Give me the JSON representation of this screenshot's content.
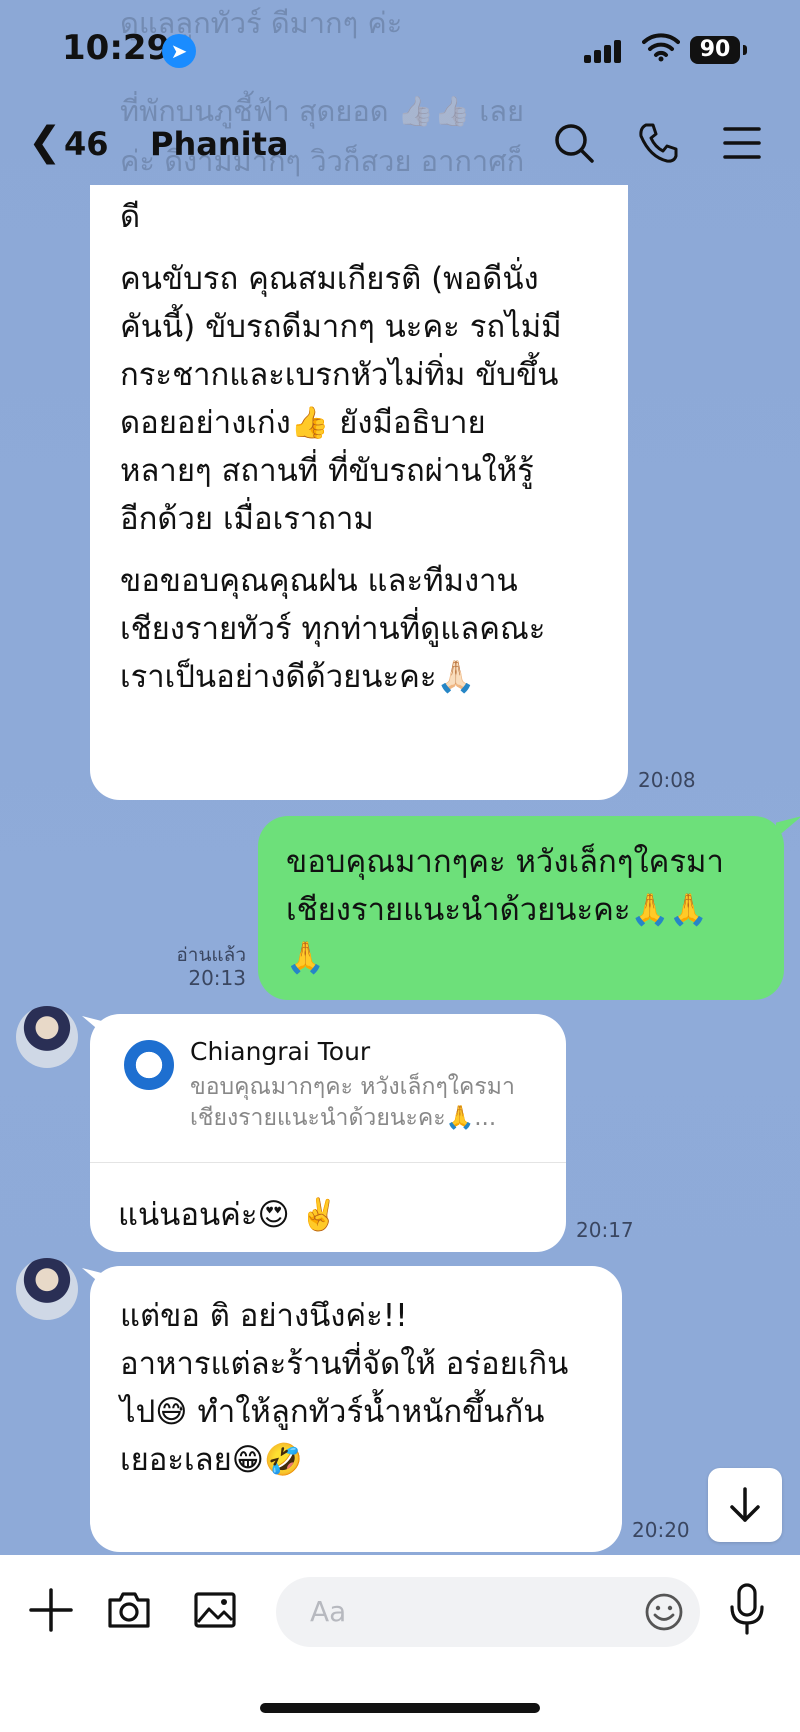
{
  "status": {
    "time": "10:29",
    "battery": "90"
  },
  "header": {
    "back_count": "46",
    "contact_name": "Phanita"
  },
  "ghost_text": [
    "ดูแลลูกทัวร์ ดีมากๆ ค่ะ",
    "ที่พักบนภูชี้ฟ้า สุดยอด 👍🏻👍🏻 เลย",
    "ค่ะ ดีงามมากๆ วิวก็สวย อากาศก็"
  ],
  "messages": {
    "m1": {
      "lines": [
        "ดี",
        "",
        "คนขับรถ คุณสมเกียรติ (พอดีนั่ง",
        "คันนี้) ขับรถดีมากๆ นะคะ รถไม่มี",
        "กระชากและเบรกหัวไม่ทิ่ม ขับขึ้น",
        "ดอยอย่างเก่ง👍 ยังมีอธิบาย",
        "หลายๆ สถานที่ ที่ขับรถผ่านให้รู้",
        "อีกด้วย เมื่อเราถาม",
        "",
        "ขอขอบคุณคุณฝน และทีมงาน",
        "เชียงรายทัวร์ ทุกท่านที่ดูแลคณะ",
        "เราเป็นอย่างดีด้วยนะคะ🙏🏻"
      ],
      "time": "20:08"
    },
    "m2": {
      "lines": [
        "ขอบคุณมากๆคะ หวังเล็กๆใครมา",
        "เชียงรายแนะนำด้วยนะคะ🙏🙏",
        "🙏"
      ],
      "read": "อ่านแล้ว",
      "time": "20:13"
    },
    "m3": {
      "reply_title": "Chiangrai Tour",
      "reply_lines": [
        "ขอบคุณมากๆคะ หวังเล็กๆใครมา",
        "เชียงรายแนะนำด้วยนะคะ🙏..."
      ],
      "text": "แน่นอนค่ะ😍 ✌️",
      "time": "20:17"
    },
    "m4": {
      "lines": [
        "แต่ขอ ติ อย่างนึงค่ะ!!",
        "",
        "อาหารแต่ละร้านที่จัดให้ อร่อยเกิน",
        "ไป😅 ทำให้ลูกทัวร์น้ำหนักขึ้นกัน",
        "เยอะเลย😁🤣"
      ],
      "time": "20:20"
    }
  },
  "input": {
    "placeholder": "Aa"
  },
  "colors": {
    "chat_bg": "#8eaad8",
    "sent_bubble": "#6de07a",
    "received_bubble": "#ffffff"
  }
}
